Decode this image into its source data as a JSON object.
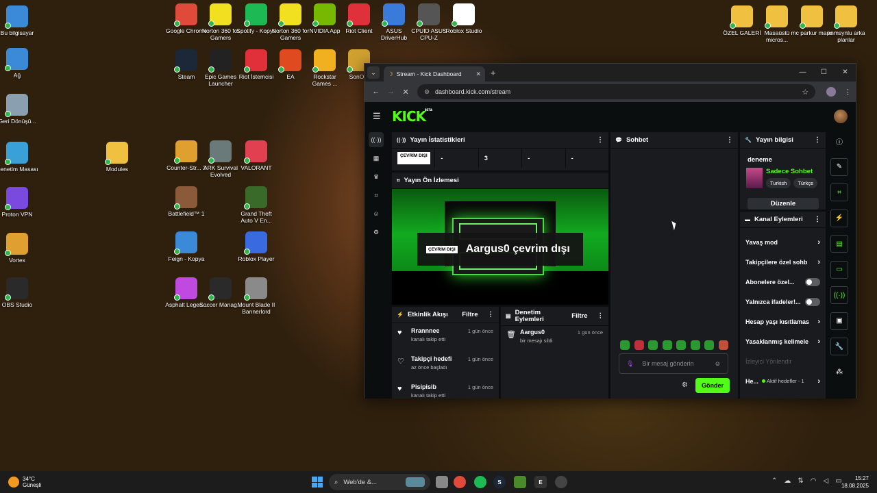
{
  "desktop": {
    "icons": [
      {
        "label": "Bu bilgisayar",
        "icon": "computer-icon",
        "color": "#3a8ad8"
      },
      {
        "label": "Ağ",
        "icon": "network-icon",
        "color": "#3a8ad8"
      },
      {
        "label": "Geri Dönüşü...",
        "icon": "recycle-bin-icon",
        "color": "#8aa0b0"
      },
      {
        "label": "Denetim Masası",
        "icon": "control-panel-icon",
        "color": "#3aa0d8"
      },
      {
        "label": "Proton VPN",
        "icon": "proton-vpn-icon",
        "color": "#7a4ae0"
      },
      {
        "label": "Vortex",
        "icon": "vortex-icon",
        "color": "#e0a030"
      },
      {
        "label": "OBS Studio",
        "icon": "obs-icon",
        "color": "#2a2a2a"
      },
      {
        "label": "Modules",
        "icon": "folder-icon",
        "color": "#f0c040"
      },
      {
        "label": "Google Chrome",
        "icon": "chrome-icon",
        "color": "#e04a3a"
      },
      {
        "label": "Norton 360 for Gamers",
        "icon": "norton-icon",
        "color": "#f0e020"
      },
      {
        "label": "Spotify - Kopya",
        "icon": "spotify-icon",
        "color": "#1db954"
      },
      {
        "label": "Norton 360 for Gamers",
        "icon": "norton-icon",
        "color": "#f0e020"
      },
      {
        "label": "NVIDIA App",
        "icon": "nvidia-icon",
        "color": "#76b900"
      },
      {
        "label": "Riot Client",
        "icon": "riot-icon",
        "color": "#e0303a"
      },
      {
        "label": "ASUS DriverHub",
        "icon": "asus-icon",
        "color": "#3a7ad8"
      },
      {
        "label": "CPUID ASUS CPU-Z",
        "icon": "cpuz-icon",
        "color": "#555555"
      },
      {
        "label": "Roblox Studio",
        "icon": "roblox-studio-icon",
        "color": "#ffffff"
      },
      {
        "label": "Steam",
        "icon": "steam-icon",
        "color": "#1b2838"
      },
      {
        "label": "Epic Games Launcher",
        "icon": "epic-icon",
        "color": "#222222"
      },
      {
        "label": "Riot İstemcisi",
        "icon": "riot-icon",
        "color": "#e0303a"
      },
      {
        "label": "EA",
        "icon": "ea-icon",
        "color": "#e04a20"
      },
      {
        "label": "Rockstar Games ...",
        "icon": "rockstar-icon",
        "color": "#f0b020"
      },
      {
        "label": "SonO...",
        "icon": "app-icon",
        "color": "#d0a030"
      },
      {
        "label": "Counter-Str... 2",
        "icon": "cs2-icon",
        "color": "#e0a030"
      },
      {
        "label": "ARK Survival Evolved",
        "icon": "ark-icon",
        "color": "#6a7a7a"
      },
      {
        "label": "VALORANT",
        "icon": "valorant-icon",
        "color": "#e04050"
      },
      {
        "label": "Battlefield™ 1",
        "icon": "battlefield-icon",
        "color": "#8a5a3a"
      },
      {
        "label": "Grand Theft Auto V En...",
        "icon": "gta-icon",
        "color": "#3a6a2a"
      },
      {
        "label": "Feign - Kopya",
        "icon": "feign-icon",
        "color": "#3a8ad8"
      },
      {
        "label": "Roblox Player",
        "icon": "roblox-icon",
        "color": "#3a6ae0"
      },
      {
        "label": "Asphalt Legen...",
        "icon": "asphalt-icon",
        "color": "#c04ae0"
      },
      {
        "label": "Soccer Manag...",
        "icon": "soccer-manager-icon",
        "color": "#2a2a2a"
      },
      {
        "label": "Mount  Blade II Bannerlord",
        "icon": "bannerlord-icon",
        "color": "#8a8a8a"
      },
      {
        "label": "ÖZEL GALERİ",
        "icon": "folder-icon",
        "color": "#f0c040"
      },
      {
        "label": "Masaüstü micros...",
        "icon": "folder-icon",
        "color": "#f0c040"
      },
      {
        "label": "mc parkur maps",
        "icon": "folder-icon",
        "color": "#f0c040"
      },
      {
        "label": "anmsynlu arka planlar",
        "icon": "folder-icon",
        "color": "#f0c040"
      }
    ]
  },
  "browser": {
    "tab_title": "Stream - Kick Dashboard",
    "url": "dashboard.kick.com/stream"
  },
  "kick": {
    "logo": "KICK",
    "logo_sup": "BETA",
    "stats": {
      "title": "Yayın İstatistikleri",
      "status_badge": "ÇEVRİM DIŞI",
      "values": [
        "-",
        "3",
        "-",
        "-"
      ]
    },
    "preview": {
      "title": "Yayın Ön İzlemesi",
      "badge": "ÇEVRİM DIŞI",
      "message": "Aargus0 çevrim dışı"
    },
    "feed": {
      "title": "Etkinlik Akışı",
      "filter": "Filtre",
      "events": [
        {
          "name": "Rrannnee",
          "desc": "kanalı takip etti",
          "time": "1 gün önce"
        },
        {
          "name": "Takipçi hedefi",
          "desc": "az önce başladı",
          "time": "1 gün önce"
        },
        {
          "name": "Pisipisib",
          "desc": "kanalı takip etti",
          "time": "1 gün önce"
        }
      ]
    },
    "modlog": {
      "title": "Denetim Eylemleri",
      "filter": "Filtre",
      "entries": [
        {
          "name": "Aargus0",
          "desc": "bir mesajı sildi",
          "time": "1 gün önce"
        }
      ]
    },
    "chat": {
      "title": "Sohbet",
      "placeholder": "Bir mesaj gönderin",
      "send": "Gönder"
    },
    "info": {
      "title": "Yayın bilgisi",
      "stream_title": "deneme",
      "category": "Sadece Sohbet",
      "tags": [
        "Turkish",
        "Türkçe"
      ],
      "edit": "Düzenle"
    },
    "actions": {
      "title": "Kanal Eylemleri",
      "items": [
        {
          "label": "Yavaş mod",
          "control": "chevron"
        },
        {
          "label": "Takipçilere özel sohb",
          "control": "chevron"
        },
        {
          "label": "Abonelere özel...",
          "control": "toggle",
          "on": false
        },
        {
          "label": "Yalnızca ifadeler!...",
          "control": "toggle",
          "on": false
        },
        {
          "label": "Hesap yaşı kısıtlamas",
          "control": "chevron"
        },
        {
          "label": "Yasaklanmış kelimele",
          "control": "chevron"
        },
        {
          "label": "İzleyici Yönlendir",
          "control": "none"
        },
        {
          "label": "He...",
          "control": "chevron",
          "extra": "Aktif hedefler - 1"
        }
      ]
    }
  },
  "taskbar": {
    "temp": "34°C",
    "weather": "Güneşli",
    "search": "Web'de &...",
    "time": "15:27",
    "date": "18.08.2025"
  }
}
